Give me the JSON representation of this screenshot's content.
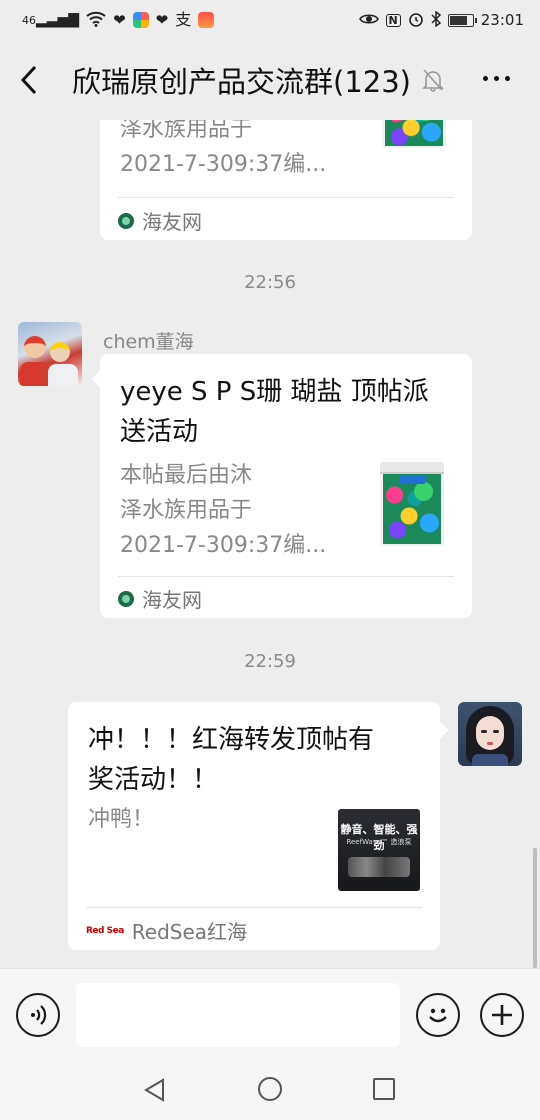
{
  "status_bar": {
    "network": "46",
    "time": "23:01"
  },
  "header": {
    "title": "欣瑞原创产品交流群(123)",
    "back_icon": "chevron-left-icon",
    "mute_icon": "bell-off-icon",
    "more_icon": "more-dots-icon"
  },
  "messages": {
    "card1": {
      "desc_line1": "泽水族用品于",
      "desc_line2": "2021-7-309:37编...",
      "source": "海友网"
    },
    "time1": "22:56",
    "msg2": {
      "sender": "chem董海",
      "title_line1": "yeye S P S珊 瑚盐 顶帖派",
      "title_line2": "送活动",
      "desc_line1": "本帖最后由沐",
      "desc_line2": "泽水族用品于",
      "desc_line3": "2021-7-309:37编...",
      "source": "海友网"
    },
    "time2": "22:59",
    "msg3": {
      "title_line1": "冲！！！红海转发顶帖有",
      "title_line2": "奖活动！！",
      "desc": "冲鸭！",
      "thumb_text": "静音、智能、强劲",
      "thumb_sub": "ReefWave™ 造浪泵",
      "source_logo": "Red Sea",
      "source": "RedSea红海"
    }
  },
  "input_bar": {
    "voice_icon": "voice-icon",
    "emoji_icon": "emoji-icon",
    "plus_icon": "plus-icon"
  },
  "system_nav": {
    "back": "triangle-back-icon",
    "home": "circle-home-icon",
    "recent": "square-recent-icon"
  },
  "colors": {
    "background": "#ededed",
    "bubble": "#ffffff",
    "secondary_text": "#888888"
  }
}
